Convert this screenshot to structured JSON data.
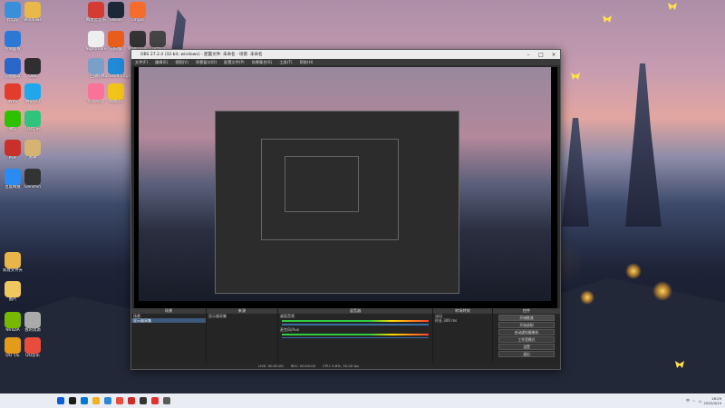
{
  "desktop_icons": [
    {
      "label": "此电脑",
      "color": "#3a8fd9"
    },
    {
      "label": "Windows",
      "color": "#e8b84a"
    },
    {
      "label": "网易云音乐",
      "color": "#d43c33"
    },
    {
      "label": "Steam",
      "color": "#1b2838"
    },
    {
      "label": "Origin",
      "color": "#f56c2d"
    },
    {
      "label": "控制面板",
      "color": "#2a7ad5"
    },
    {
      "label": "Nightmare",
      "color": "#eee"
    },
    {
      "label": "Wallpaper",
      "color": "#333"
    },
    {
      "label": "向日葵",
      "color": "#e85d1c"
    },
    {
      "label": "Cortana",
      "color": "#444"
    },
    {
      "label": "动图截取",
      "color": "#2b66c9"
    },
    {
      "label": "OBS",
      "color": "#302e31"
    },
    {
      "label": "回收站",
      "color": "#7aa0c8"
    },
    {
      "label": "Microsoft Edge",
      "color": "#1f8ad6"
    },
    {
      "label": "WPS",
      "color": "#e23c2c"
    },
    {
      "label": "腾讯QQ",
      "color": "#1fa7ec"
    },
    {
      "label": "哔哩哔哩",
      "color": "#fb7299"
    },
    {
      "label": "网易UU",
      "color": "#f0c419"
    },
    {
      "label": "微信",
      "color": "#2dc100"
    },
    {
      "label": "QQ音乐",
      "color": "#31c27c"
    },
    {
      "label": "PDF",
      "color": "#c9302c"
    },
    {
      "label": "原神",
      "color": "#d4b373"
    },
    {
      "label": "百度网盘",
      "color": "#2a8cf1"
    },
    {
      "label": "Genshin",
      "color": "#333"
    },
    {
      "label": "新建文件夹",
      "color": "#e7b54a"
    },
    {
      "label": "图片",
      "color": "#f0c75e"
    },
    {
      "label": "NVIDIA",
      "color": "#76b900"
    },
    {
      "label": "我的资源",
      "color": "#aaa"
    },
    {
      "label": "QQ飞车",
      "color": "#e49b1a"
    },
    {
      "label": "QQ音乐",
      "color": "#e84c3d"
    }
  ],
  "obs": {
    "title": "OBS 27.2.4 (32-bit, windows) - 配置文件: 未命名 - 场景: 未命名",
    "menu": [
      "文件(F)",
      "编辑(E)",
      "视图(V)",
      "停靠窗口(D)",
      "配置文件(P)",
      "场景集合(S)",
      "工具(T)",
      "帮助(H)"
    ],
    "panels": {
      "scenes_header": "场景",
      "scenes": [
        "场景"
      ],
      "sources_header": "来源",
      "sources": [
        "显示器采集"
      ],
      "mixer_header": "混音器",
      "mixer": [
        {
          "name": "桌面音频",
          "level": "0.0 dB"
        },
        {
          "name": "麦克风/Aux",
          "level": "0.0 dB"
        }
      ],
      "transitions_header": "转场特效",
      "transition_type": "淡出",
      "transition_duration_label": "时长",
      "transition_duration": "300 ms",
      "controls_header": "控件",
      "controls": [
        "开始推流",
        "开始录制",
        "启动虚拟摄像机",
        "工作室模式",
        "设置",
        "退出"
      ]
    },
    "status": {
      "live": "LIVE: 00:00:00",
      "rec": "REC: 00:00:00",
      "cpu": "CPU: 5.6%, 30.00 fps"
    }
  },
  "taskbar": {
    "time": "18:29",
    "date": "2022/4/14",
    "ime": "中",
    "icon_colors": [
      "#0b5ed7",
      "#1c1c1c",
      "#0078d4",
      "#f2b01e",
      "#2b88d8",
      "#e84c3d",
      "#cd2a2a",
      "#333",
      "#e03030",
      "#5a5a5a"
    ]
  }
}
